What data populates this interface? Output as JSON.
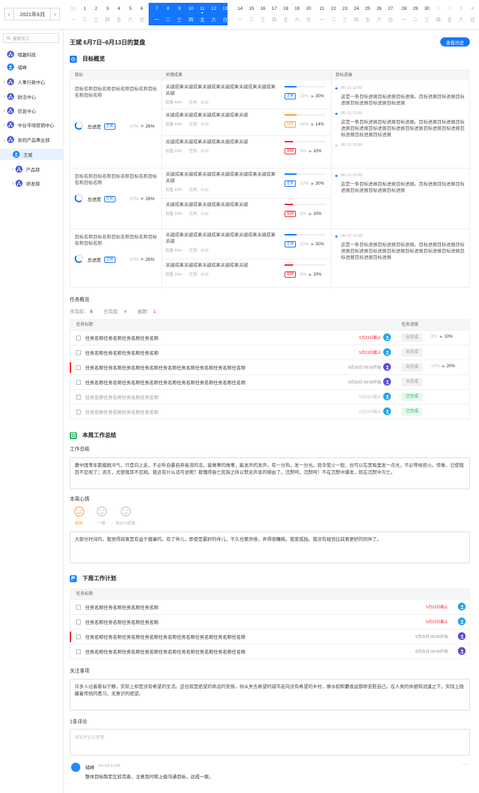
{
  "datebar": {
    "month": "2021年6月",
    "prev_icon": "chevron-left-icon",
    "next_icon": "chevron-right-icon",
    "days": [
      {
        "n": "31",
        "w": "一"
      },
      {
        "n": "1",
        "w": "二"
      },
      {
        "n": "2",
        "w": "三"
      },
      {
        "n": "3",
        "w": "四"
      },
      {
        "n": "4",
        "w": "五"
      },
      {
        "n": "5",
        "w": "六"
      },
      {
        "n": "6",
        "w": "日"
      },
      {
        "n": "7",
        "w": "一"
      },
      {
        "n": "8",
        "w": "二"
      },
      {
        "n": "9",
        "w": "三"
      },
      {
        "n": "10",
        "w": "四"
      },
      {
        "n": "11",
        "w": "五"
      },
      {
        "n": "12",
        "w": "六"
      },
      {
        "n": "13",
        "w": "日"
      },
      {
        "n": "14",
        "w": "一"
      },
      {
        "n": "15",
        "w": "二"
      },
      {
        "n": "16",
        "w": "三"
      },
      {
        "n": "17",
        "w": "四"
      },
      {
        "n": "18",
        "w": "五"
      },
      {
        "n": "19",
        "w": "六"
      },
      {
        "n": "20",
        "w": "日"
      },
      {
        "n": "21",
        "w": "一"
      },
      {
        "n": "22",
        "w": "二"
      },
      {
        "n": "23",
        "w": "三"
      },
      {
        "n": "24",
        "w": "四"
      },
      {
        "n": "25",
        "w": "五"
      },
      {
        "n": "26",
        "w": "六"
      },
      {
        "n": "27",
        "w": "日"
      },
      {
        "n": "28",
        "w": "一"
      },
      {
        "n": "29",
        "w": "二"
      },
      {
        "n": "30",
        "w": "三"
      },
      {
        "n": "1",
        "w": "四"
      },
      {
        "n": "2",
        "w": "五"
      },
      {
        "n": "3",
        "w": "六"
      },
      {
        "n": "4",
        "w": "日"
      }
    ],
    "selected_range": [
      7,
      13
    ],
    "today_index": 11
  },
  "sidebar": {
    "search_placeholder": "搜索员工",
    "items": [
      {
        "label": "嘿趣科技",
        "arrow": "",
        "icon": "org-icon"
      },
      {
        "label": "储峰",
        "arrow": "",
        "icon": "person-icon"
      },
      {
        "label": "人事行政中心",
        "arrow": "›",
        "icon": "org-icon"
      },
      {
        "label": "财法中心",
        "arrow": "›",
        "icon": "org-icon"
      },
      {
        "label": "信息中心",
        "arrow": "›",
        "icon": "org-icon"
      },
      {
        "label": "中台市场营销中心",
        "arrow": "›",
        "icon": "org-icon"
      },
      {
        "label": "协同产品事业部",
        "arrow": "⌄",
        "icon": "org-icon"
      },
      {
        "label": "王斌",
        "arrow": "",
        "icon": "person-icon",
        "active": true
      },
      {
        "label": "产品部",
        "arrow": "›",
        "icon": "org-icon"
      },
      {
        "label": "研发部",
        "arrow": "›",
        "icon": "org-icon"
      }
    ]
  },
  "header": {
    "title": "王斌  6月7日–6月13日的复盘",
    "history_button": "查看历史"
  },
  "goals": {
    "section_title": "目标概览",
    "col_goal": "目标",
    "col_kr": "关键成果",
    "col_progress": "目标进展",
    "rows": [
      {
        "name": "目标名称目标名称目标名称目标名称目标名称目标名称",
        "total_label": "总进度",
        "total_tag": "正常",
        "total_prev": "10%",
        "total_now": "26%",
        "krs": [
          {
            "text": "关键成果关键成果关键成果关键成果关键成果关键成果关键",
            "weight": "权重 40%",
            "tasks": "任务：2/10",
            "tag": "正常",
            "color": "#1476ff",
            "prev": "20%",
            "now": "30%",
            "fill": 0.3
          },
          {
            "text": "关键成果关键成果关键成果关键成果关键",
            "weight": "权重 40%",
            "tasks": "任务：2/10",
            "tag": "风险",
            "color": "#ff9a2e",
            "prev": "14%",
            "now": "14%",
            "fill": 0.3
          },
          {
            "text": "关键成果关键成果关键成果关键成果关键",
            "weight": "权重 20%",
            "tasks": "任务：2/10",
            "tag": "延期",
            "color": "#f5222d",
            "prev": "8%",
            "now": "10%",
            "fill": 0.2
          }
        ],
        "progress": [
          {
            "time": "06–11 12:00",
            "text": "这是一条目标进展目标进展目标进展。目标进展目标进展目标进展目标进展目标进展目标进展"
          },
          {
            "time": "06–11 12:00",
            "text": "这是一条目标进展目标进展目标进展。目标进展目标进展目标进展目标进展目标进展目标进展目标进展目标进展目标进展目标进展目标进展目标进展"
          },
          {
            "time": "06–11 12:00",
            "text": ""
          }
        ]
      },
      {
        "name": "目标名称目标名称目标名称目标名称目标名称目标名称",
        "total_label": "总进度",
        "total_tag": "正常",
        "total_prev": "10%",
        "total_now": "26%",
        "krs": [
          {
            "text": "关键成果关键成果关键成果关键成果关键成果关键成果关键",
            "weight": "权重 40%",
            "tasks": "任务：2/10",
            "tag": "正常",
            "color": "#1476ff",
            "prev": "20%",
            "now": "30%",
            "fill": 0.3
          },
          {
            "text": "关键成果关键成果关键成果关键成果关键",
            "weight": "权重 20%",
            "tasks": "任务：2/10",
            "tag": "延期",
            "color": "#f5222d",
            "prev": "8%",
            "now": "10%",
            "fill": 0.2
          }
        ],
        "progress": [
          {
            "time": "06–11 12:00",
            "text": "这是一条目标进展目标进展目标进展。目标进展目标进展目标进展目标进展目标进展目标进展"
          }
        ]
      },
      {
        "name": "目标名称目标名称目标名称目标名称目标名称目标名称",
        "total_label": "总进度",
        "total_tag": "正常",
        "total_prev": "10%",
        "total_now": "26%",
        "krs": [
          {
            "text": "关键成果关键成果关键成果关键成果关键成果关键成果关键",
            "weight": "权重 40%",
            "tasks": "任务：2/10",
            "tag": "正常",
            "color": "#1476ff",
            "prev": "20%",
            "now": "30%",
            "fill": 0.3
          },
          {
            "text": "关键成果关键成果关键成果关键成果关键",
            "weight": "权重 20%",
            "tasks": "任务：2/10",
            "tag": "延期",
            "color": "#f5222d",
            "prev": "8%",
            "now": "10%",
            "fill": 0.2
          }
        ],
        "progress": [
          {
            "time": "06–07 12:00",
            "text": "这是一条目标进展目标进展目标进展。目标进展目标进展目标进展目标进展目标进展目标进展目标进展目标进展目标进展目标进展目标进展目标进展"
          }
        ]
      }
    ]
  },
  "tasks": {
    "title": "任务概览",
    "unfinished_label": "未完成：",
    "unfinished": "6",
    "finished_label": "已完成：",
    "finished": "4",
    "overdue_label": "逾期：",
    "overdue": "1",
    "col_title": "任务标题",
    "col_progress": "任务进度",
    "rows": [
      {
        "name": "任务名称任务名称任务名称任务名称",
        "date": "5月23日截止",
        "date_style": "red",
        "avatar": "blue",
        "status": "未完成",
        "prev": "8%",
        "now": "10%",
        "checked": false,
        "flag": false
      },
      {
        "name": "任务名称任务名称任务名称任务名称",
        "date": "5月23日截止",
        "date_style": "red",
        "avatar": "blue",
        "status": "未完成",
        "prev": "",
        "now": "",
        "checked": false,
        "flag": false
      },
      {
        "name": "任务名称任务名称任务名称任务名称任务名称任务名称任务名称任务名称任名称",
        "date": "6月25日 09:00开始",
        "date_style": "",
        "avatar": "purple",
        "status": "未完成",
        "prev": "12%",
        "now": "20%",
        "checked": false,
        "flag": true
      },
      {
        "name": "任务名称任务名称任务名称任务名称任务名称任务名称任务名称任务名称任名称",
        "date": "6月25日 09:00开始",
        "date_style": "",
        "avatar": "purple",
        "status": "未完成",
        "prev": "",
        "now": "",
        "checked": false,
        "flag": false
      },
      {
        "name": "任务名称任务名称任务名称任务名称",
        "date": "5月23日截止",
        "date_style": "grey",
        "avatar": "blue",
        "status": "已完成",
        "prev": "",
        "now": "",
        "checked": true,
        "flag": false
      },
      {
        "name": "任务名称任务名称任务名称任务名称",
        "date": "5月23日截止",
        "date_style": "grey",
        "avatar": "blue",
        "status": "已完成",
        "prev": "",
        "now": "",
        "checked": true,
        "flag": false
      }
    ]
  },
  "summary": {
    "section_title": "本周工作总结",
    "work_label": "工作总结",
    "work_text": "蘑中国青年都摸脱冷气，只是向上走，不必听自暴自弃者流的话。能做事的做事，能发声的发声。有一分热，发一分光。就令萤火一般，也可以在黑暗里发一点光，不必等候炬火。惨象，已使我目不忍视了；流言，尤使我耳不忍闻。我还有什么话可说呢？我懂得衰亡民族之所以默无声息的缘由了。沉默呵，沉默呵！不在沉默中爆发，就在沉默中灭亡。",
    "mood_label": "本周心情",
    "moods": [
      "超热",
      "一般",
      "有点小低落"
    ],
    "mood_text": "大部分时间内，我觉得寂寞是有益于健康的。有了伴儿，即使是最好的伴儿，不久也要厌倦，弄得很糟糕。我爱孤独。我没有碰到比寂寞更好的同伴了。"
  },
  "plan": {
    "section_title": "下周工作计划",
    "col_title": "任务标题",
    "rows": [
      {
        "name": "任务名称任务名称任务名称任务名称",
        "date": "5月23日截止",
        "date_style": "red",
        "avatar": "blue",
        "flag": false
      },
      {
        "name": "任务名称任务名称任务名称任务名称",
        "date": "5月23日截止",
        "date_style": "red",
        "avatar": "blue",
        "flag": false
      },
      {
        "name": "任务名称任务名称任务名称任务名称任务名称任务名称任务名称任务名称任名称",
        "date": "6月25日 09:00开始",
        "date_style": "",
        "avatar": "purple",
        "flag": true
      },
      {
        "name": "任务名称任务名称任务名称任务名称任务名称任务名称任务名称任务名称任名称",
        "date": "6月25日 09:00开始",
        "date_style": "",
        "avatar": "purple",
        "flag": false
      }
    ],
    "notes_label": "关注事项",
    "notes_text": "许多人过着看似宁静，实际上却是没有希望的生活。这也就是绝望的命运的安排。你从失去希望的城市走向没有希望的乡村，像水貂和麝香鼠那样安慰自己。在人类的休憩和消遣之下，实际上隐藏着传统的悉习，无意识的绝望。"
  },
  "comments": {
    "count_label": "1条评论",
    "placeholder": "添加评论与反馈",
    "items": [
      {
        "name": "储峰",
        "time": "04–09 12:00",
        "text": "整体目标制定比较完善，注意及时和上级沟通目标，达成一致。"
      }
    ]
  },
  "colors": {
    "accent": "#1476ff",
    "risk": "#ff9a2e",
    "delay": "#f5222d",
    "done": "#1fb65a",
    "org_icon": "#4a5ad6"
  }
}
